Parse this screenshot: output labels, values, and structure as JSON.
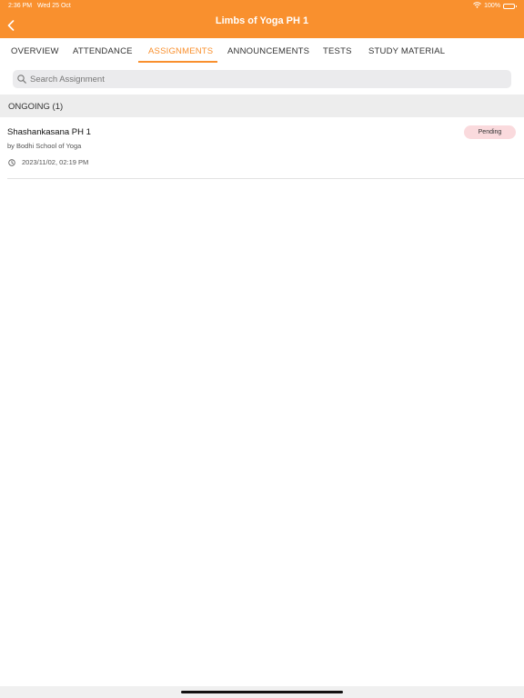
{
  "status_bar": {
    "time": "2:36 PM",
    "date": "Wed 25 Oct",
    "battery": "100%"
  },
  "header": {
    "title": "Limbs of Yoga PH 1",
    "color": "#f9902e"
  },
  "tabs": [
    {
      "label": "OVERVIEW"
    },
    {
      "label": "ATTENDANCE"
    },
    {
      "label": "ASSIGNMENTS",
      "active": true
    },
    {
      "label": "ANNOUNCEMENTS"
    },
    {
      "label": "TESTS"
    },
    {
      "label": "STUDY MATERIAL"
    }
  ],
  "search": {
    "placeholder": "Search Assignment",
    "value": ""
  },
  "sections": [
    {
      "title": "ONGOING (1)",
      "items": [
        {
          "title": "Shashankasana PH 1",
          "author": "by Bodhi School of Yoga",
          "datetime": "2023/11/02, 02:19 PM",
          "status": "Pending",
          "status_color": "#fadadd"
        }
      ]
    }
  ],
  "icons": {
    "back": "chevron-left-icon",
    "search": "search-icon",
    "clock": "clock-icon",
    "wifi": "wifi-icon",
    "battery": "battery-icon"
  }
}
